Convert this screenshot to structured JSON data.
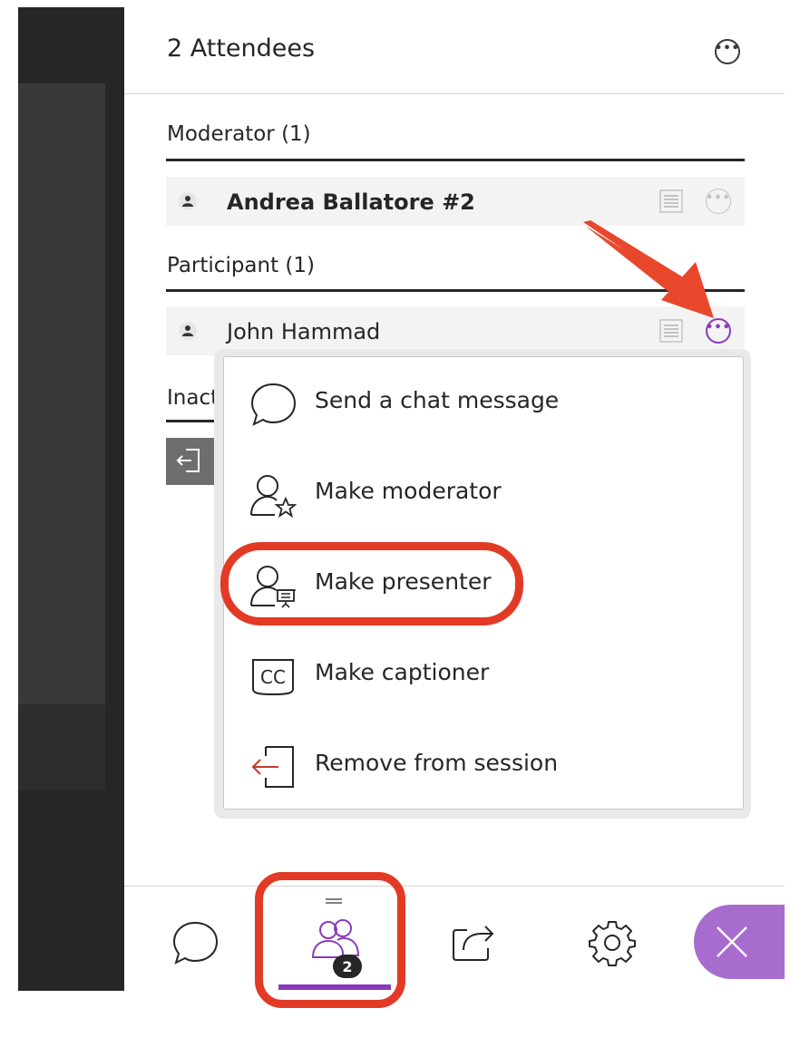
{
  "header": {
    "title": "2 Attendees"
  },
  "sections": {
    "moderator": {
      "title": "Moderator (1)",
      "attendees": [
        {
          "name": "Andrea Ballatore #2"
        }
      ]
    },
    "participant": {
      "title": "Participant (1)",
      "attendees": [
        {
          "name": "John Hammad"
        }
      ]
    },
    "inactive": {
      "title_partial": "Inact"
    }
  },
  "context_menu": {
    "items": [
      {
        "label": "Send a chat message",
        "icon": "chat-bubble-icon"
      },
      {
        "label": "Make moderator",
        "icon": "person-star-icon"
      },
      {
        "label": "Make presenter",
        "icon": "person-presentation-icon"
      },
      {
        "label": "Make captioner",
        "icon": "cc-icon"
      },
      {
        "label": "Remove from session",
        "icon": "exit-door-icon"
      }
    ]
  },
  "bottom_bar": {
    "attendee_count_badge": "2",
    "items": [
      "chat-icon",
      "attendees-icon",
      "share-content-icon",
      "settings-gear-icon",
      "close-icon"
    ]
  },
  "colors": {
    "accent_purple": "#8a3ab9",
    "close_pill": "#a86ccf",
    "highlight_red": "#e23a25",
    "dark_side": "#262626"
  }
}
